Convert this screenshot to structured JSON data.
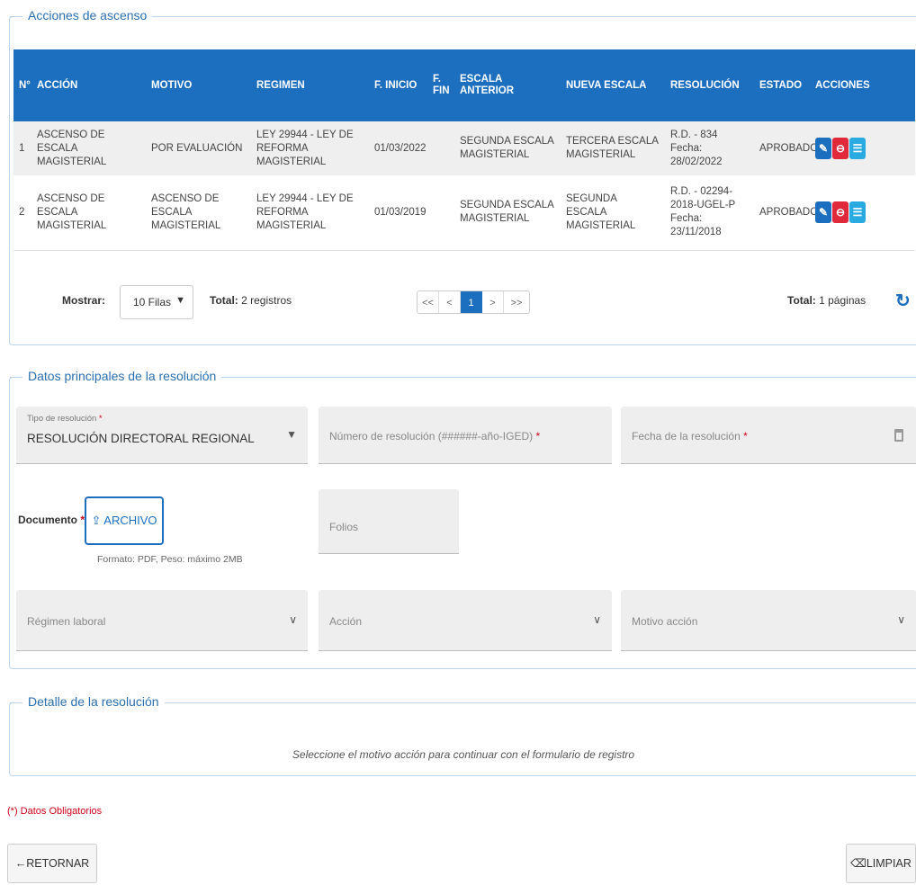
{
  "acciones": {
    "legend": "Acciones de ascenso",
    "columns": [
      "N°",
      "ACCIÓN",
      "MOTIVO",
      "REGIMEN",
      "F. INICIO",
      "F. FIN",
      "ESCALA ANTERIOR",
      "NUEVA ESCALA",
      "RESOLUCIÓN",
      "ESTADO",
      "ACCIONES"
    ],
    "rows": [
      {
        "n": "1",
        "accion": "ASCENSO DE ESCALA MAGISTERIAL",
        "motivo": "POR EVALUACIÓN",
        "regimen": "LEY 29944 - LEY DE REFORMA MAGISTERIAL",
        "f_inicio": "01/03/2022",
        "f_fin": "",
        "escala_anterior": "SEGUNDA ESCALA MAGISTERIAL",
        "nueva_escala": "TERCERA ESCALA MAGISTERIAL",
        "resolucion": "R.D. - 834",
        "resolucion_fecha": "Fecha: 28/02/2022",
        "estado": "APROBADO"
      },
      {
        "n": "2",
        "accion": "ASCENSO DE ESCALA MAGISTERIAL",
        "motivo": "ASCENSO DE ESCALA MAGISTERIAL",
        "regimen": "LEY 29944 - LEY DE REFORMA MAGISTERIAL",
        "f_inicio": "01/03/2019",
        "f_fin": "",
        "escala_anterior": "SEGUNDA ESCALA MAGISTERIAL",
        "nueva_escala": "SEGUNDA ESCALA MAGISTERIAL",
        "resolucion": "R.D. - 02294-2018-UGEL-P",
        "resolucion_fecha": "Fecha: 23/11/2018",
        "estado": "APROBADO"
      }
    ],
    "pager": {
      "mostrar_label": "Mostrar:",
      "rows_option": "10 Filas",
      "total_label": "Total:",
      "total_value": "2 registros",
      "first": "<<",
      "prev": "<",
      "current": "1",
      "next": ">",
      "last": ">>",
      "total_pages_label": "Total:",
      "total_pages_value": "1 páginas"
    }
  },
  "datos": {
    "legend": "Datos principales de la resolución",
    "tipo_label": "Tipo de resolución",
    "tipo_value": "RESOLUCIÓN DIRECTORAL REGIONAL",
    "numero_placeholder": "Número de resolución (######-año-IGED)",
    "fecha_placeholder": "Fecha de la resolución",
    "documento_label": "Documento",
    "archivo_label": "ARCHIVO",
    "formato_hint": "Formato: PDF, Peso: máximo 2MB",
    "folios_placeholder": "Folios",
    "regimen_placeholder": "Régimen laboral",
    "accion_placeholder": "Acción",
    "motivo_placeholder": "Motivo acción",
    "required_mark": "*"
  },
  "detalle": {
    "legend": "Detalle de la resolución",
    "message": "Seleccione el motivo acción para continuar con el formulario de registro"
  },
  "footer": {
    "obligatorios": "(*) Datos Obligatorios",
    "retornar": "RETORNAR",
    "limpiar": "LIMPIAR"
  },
  "colors": {
    "primary": "#1c6fbf",
    "danger": "#e0293a",
    "info": "#29abe2",
    "required": "#d0021b"
  }
}
